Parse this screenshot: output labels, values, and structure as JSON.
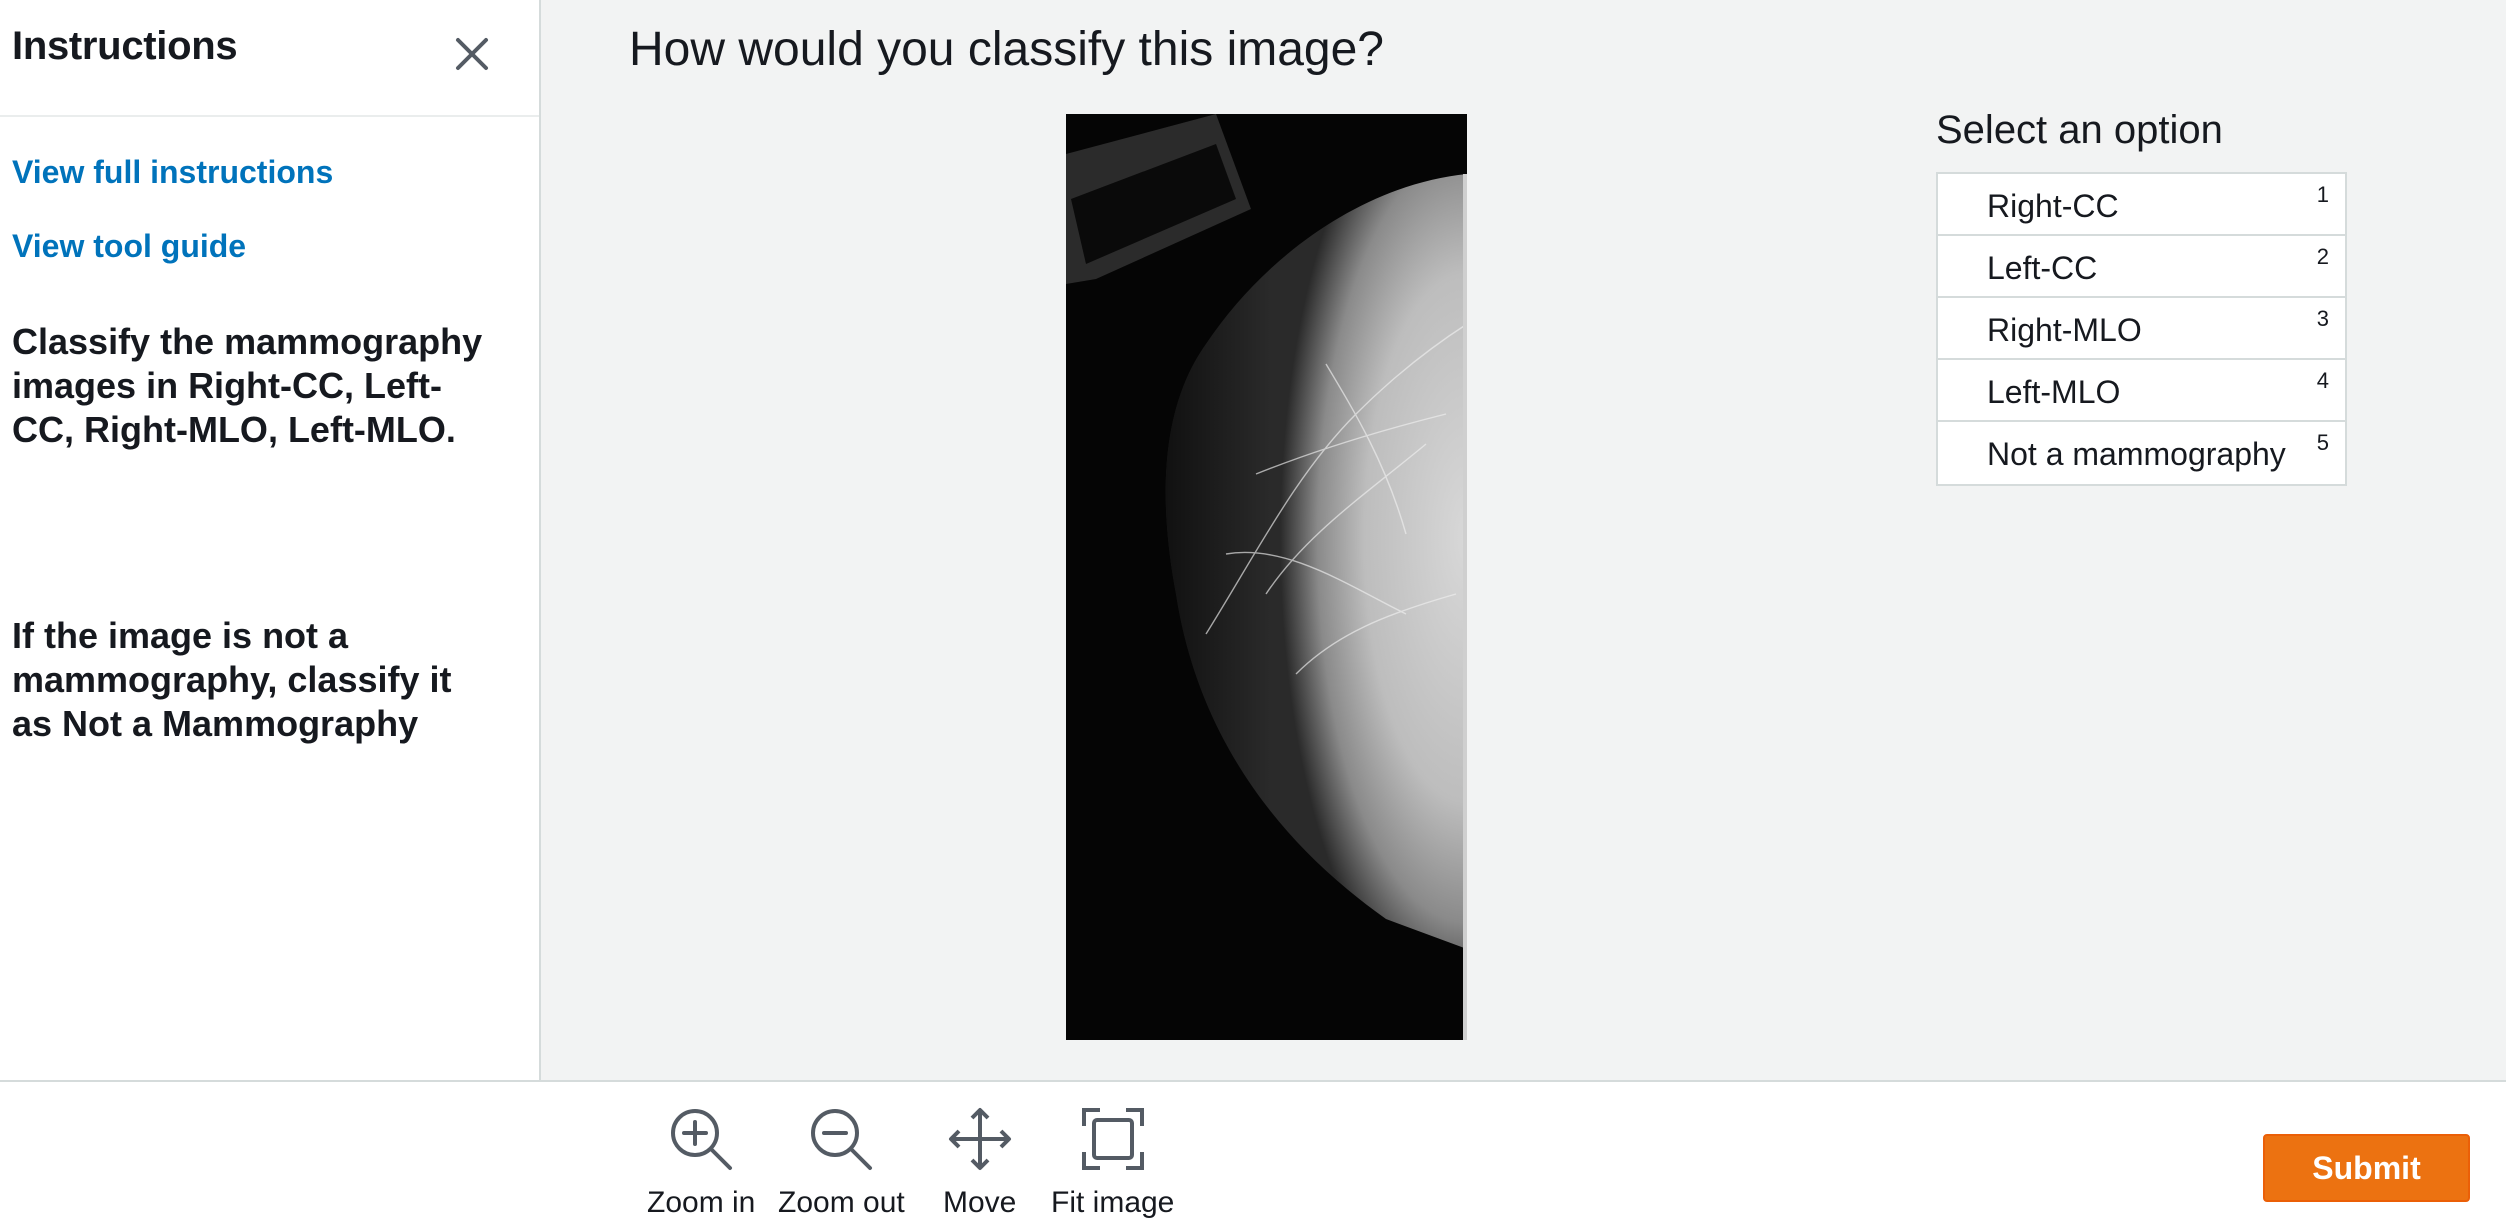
{
  "instructions_panel": {
    "title": "Instructions",
    "close_icon": "close-icon",
    "links": {
      "full_instructions": "View full instructions",
      "tool_guide": "View tool guide"
    },
    "paragraphs": [
      "Classify the mammography images in Right-CC, Left-CC, Right-MLO, Left-MLO.",
      "If the image is not a mammography, classify it as Not a Mammography"
    ]
  },
  "main": {
    "question": "How would you classify this image?",
    "image": "mammography-image"
  },
  "options_panel": {
    "title": "Select an option",
    "options": [
      {
        "label": "Right-CC",
        "key": "1"
      },
      {
        "label": "Left-CC",
        "key": "2"
      },
      {
        "label": "Right-MLO",
        "key": "3"
      },
      {
        "label": "Left-MLO",
        "key": "4"
      },
      {
        "label": "Not a mammography",
        "key": "5"
      }
    ]
  },
  "toolbar": {
    "tools": [
      {
        "label": "Zoom in",
        "icon": "zoom-in-icon"
      },
      {
        "label": "Zoom out",
        "icon": "zoom-out-icon"
      },
      {
        "label": "Move",
        "icon": "move-icon"
      },
      {
        "label": "Fit image",
        "icon": "fit-image-icon"
      }
    ],
    "submit_label": "Submit"
  },
  "colors": {
    "link": "#0073bb",
    "submit": "#ec7211",
    "background": "#f2f3f3",
    "text": "#16191f"
  }
}
